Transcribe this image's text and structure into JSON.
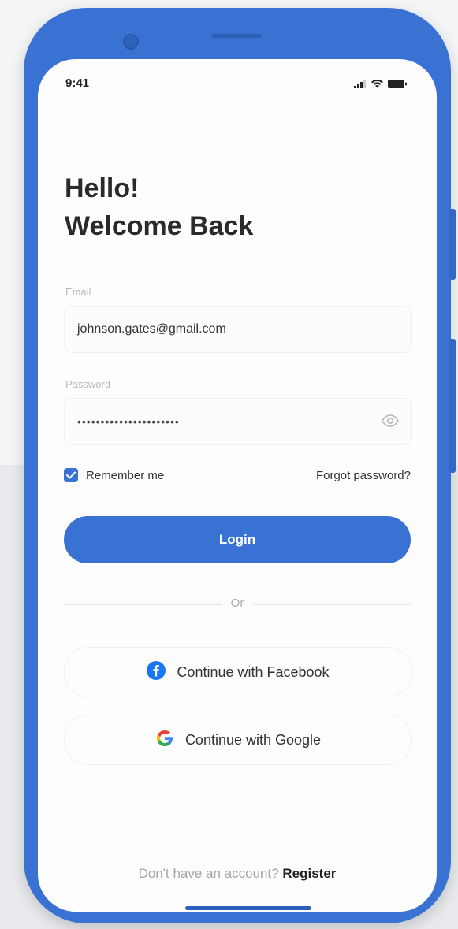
{
  "status_bar": {
    "time": "9:41"
  },
  "heading": {
    "line1": "Hello!",
    "line2": "Welcome Back"
  },
  "form": {
    "email_label": "Email",
    "email_value": "johnson.gates@gmail.com",
    "password_label": "Password",
    "password_value": "••••••••••••••••••••••",
    "remember_label": "Remember me",
    "remember_checked": true,
    "forgot_label": "Forgot password?",
    "login_label": "Login"
  },
  "divider": {
    "text": "Or"
  },
  "social": {
    "facebook_label": "Continue with Facebook",
    "google_label": "Continue with Google"
  },
  "footer": {
    "question": "Don't have an account?",
    "register_label": "Register"
  },
  "colors": {
    "accent": "#3a72d4",
    "screen_bg": "#fdfdfd",
    "text_dark": "#2a2a2a",
    "facebook": "#1877f2"
  },
  "icons": [
    "signal-icon",
    "wifi-icon",
    "battery-icon",
    "eye-icon",
    "check-icon",
    "facebook-icon",
    "google-icon"
  ]
}
